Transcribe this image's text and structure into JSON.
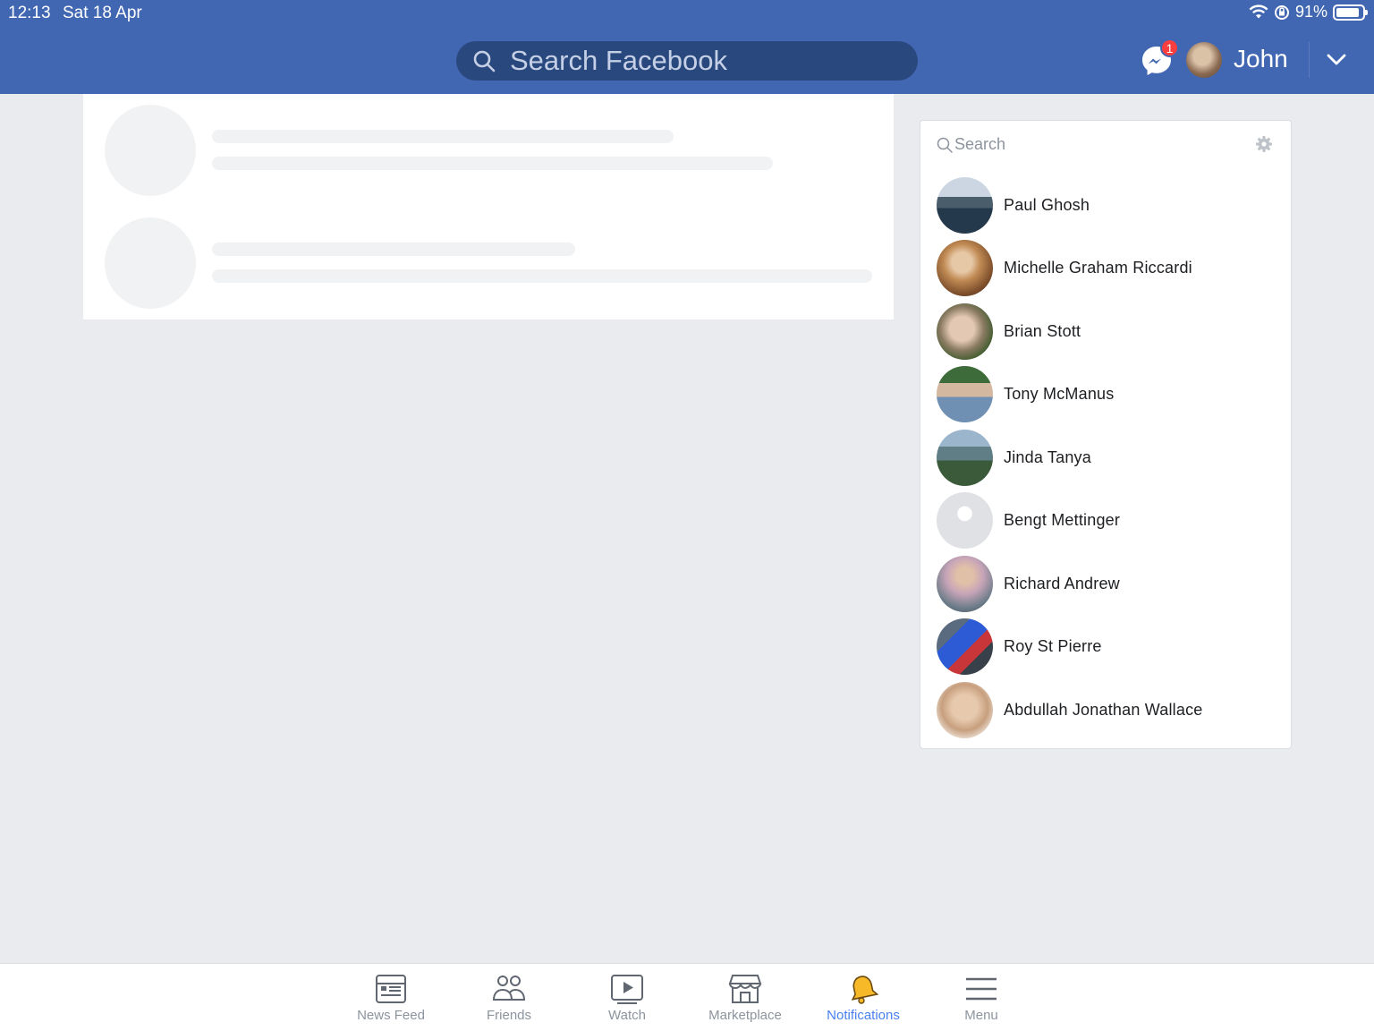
{
  "status_bar": {
    "time": "12:13",
    "date": "Sat 18 Apr",
    "battery": "91%",
    "battery_level": 0.91
  },
  "header": {
    "search_placeholder": "Search Facebook",
    "messenger_badge": "1",
    "username": "John"
  },
  "contacts": {
    "search_placeholder": "Search",
    "items": [
      {
        "name": "Paul Ghosh"
      },
      {
        "name": "Michelle Graham Riccardi"
      },
      {
        "name": "Brian Stott"
      },
      {
        "name": "Tony McManus"
      },
      {
        "name": "Jinda Tanya"
      },
      {
        "name": "Bengt Mettinger"
      },
      {
        "name": "Richard Andrew"
      },
      {
        "name": "Roy St Pierre"
      },
      {
        "name": "Abdullah Jonathan Wallace"
      }
    ]
  },
  "tabs": [
    {
      "label": "News Feed",
      "icon": "news-feed-icon"
    },
    {
      "label": "Friends",
      "icon": "friends-icon"
    },
    {
      "label": "Watch",
      "icon": "watch-icon"
    },
    {
      "label": "Marketplace",
      "icon": "marketplace-icon"
    },
    {
      "label": "Notifications",
      "icon": "bell-icon",
      "active": true
    },
    {
      "label": "Menu",
      "icon": "menu-icon"
    }
  ],
  "colors": {
    "brand": "#4267b2",
    "search_bg": "#29487d",
    "badge": "#fa3e3e",
    "active_tab": "#4a80f0",
    "bell": "#f7b928"
  }
}
